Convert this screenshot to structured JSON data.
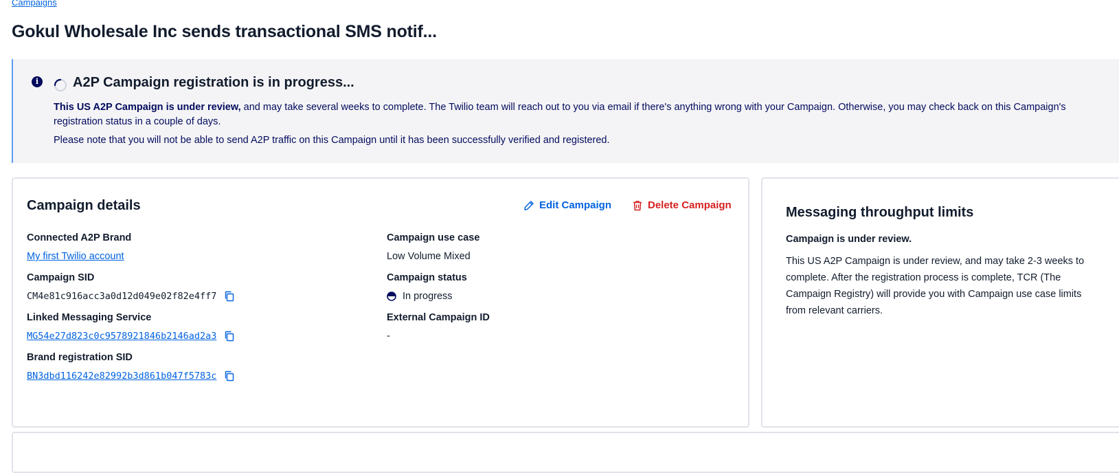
{
  "breadcrumb": {
    "label": "Campaigns"
  },
  "page": {
    "title": "Gokul Wholesale Inc sends transactional SMS notif..."
  },
  "callout": {
    "heading": "A2P Campaign registration is in progress...",
    "body_bold": "This US A2P Campaign is under review,",
    "body_text": " and may take several weeks to complete. The Twilio team will reach out to you via email if there's anything wrong with your Campaign. Otherwise, you may check back on this Campaign's registration status in a couple of days.",
    "note": "Please note that you will not be able to send A2P traffic on this Campaign until it has been successfully verified and registered."
  },
  "details": {
    "title": "Campaign details",
    "edit_label": "Edit Campaign",
    "delete_label": "Delete Campaign",
    "connected_brand": {
      "label": "Connected A2P Brand",
      "value": "My first Twilio account"
    },
    "campaign_sid": {
      "label": "Campaign SID",
      "value": "CM4e81c916acc3a0d12d049e02f82e4ff7"
    },
    "messaging_service": {
      "label": "Linked Messaging Service",
      "value": "MG54e27d823c0c9578921846b2146ad2a3"
    },
    "brand_registration_sid": {
      "label": "Brand registration SID",
      "value": "BN3dbd116242e82992b3d861b047f5783c"
    },
    "use_case": {
      "label": "Campaign use case",
      "value": "Low Volume Mixed"
    },
    "status": {
      "label": "Campaign status",
      "value": "In progress"
    },
    "external_id": {
      "label": "External Campaign ID",
      "value": "-"
    }
  },
  "limits": {
    "title": "Messaging throughput limits",
    "subtitle": "Campaign is under review.",
    "text": "This US A2P Campaign is under review, and may take 2-3 weeks to complete. After the registration process is complete, TCR (The Campaign Registry) will provide you with Campaign use case limits from relevant carriers."
  },
  "colors": {
    "accent": "#0263e0",
    "danger": "#d61f1f",
    "navy": "#030b5d",
    "callout_bg": "#f4f4f6",
    "callout_border": "#5c9cf0"
  },
  "icons": {
    "info": "info-icon",
    "spinner": "loading-spinner-icon",
    "edit": "pencil-icon",
    "delete": "trash-icon",
    "copy": "copy-icon",
    "status": "in-progress-icon"
  }
}
